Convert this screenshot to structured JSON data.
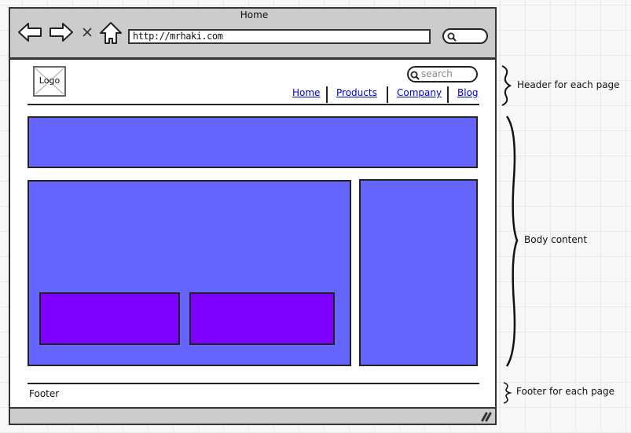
{
  "browser": {
    "window_title": "Home",
    "url": "http://mrhaki.com",
    "nav_icons": [
      "back-arrow-icon",
      "forward-arrow-icon",
      "stop-icon",
      "home-icon"
    ],
    "stop_glyph": "X"
  },
  "site_header": {
    "logo_label": "Logo",
    "search_placeholder": "search",
    "nav_links": [
      {
        "label": "Home"
      },
      {
        "label": "Products"
      },
      {
        "label": "Company"
      },
      {
        "label": "Blog"
      }
    ]
  },
  "body": {
    "colors": {
      "content_block": "#6666ff",
      "sub_block": "#7f00ff"
    }
  },
  "site_footer": {
    "label": "Footer"
  },
  "annotations": {
    "header": "Header for each page",
    "body": "Body content",
    "footer": "Footer for each page"
  }
}
